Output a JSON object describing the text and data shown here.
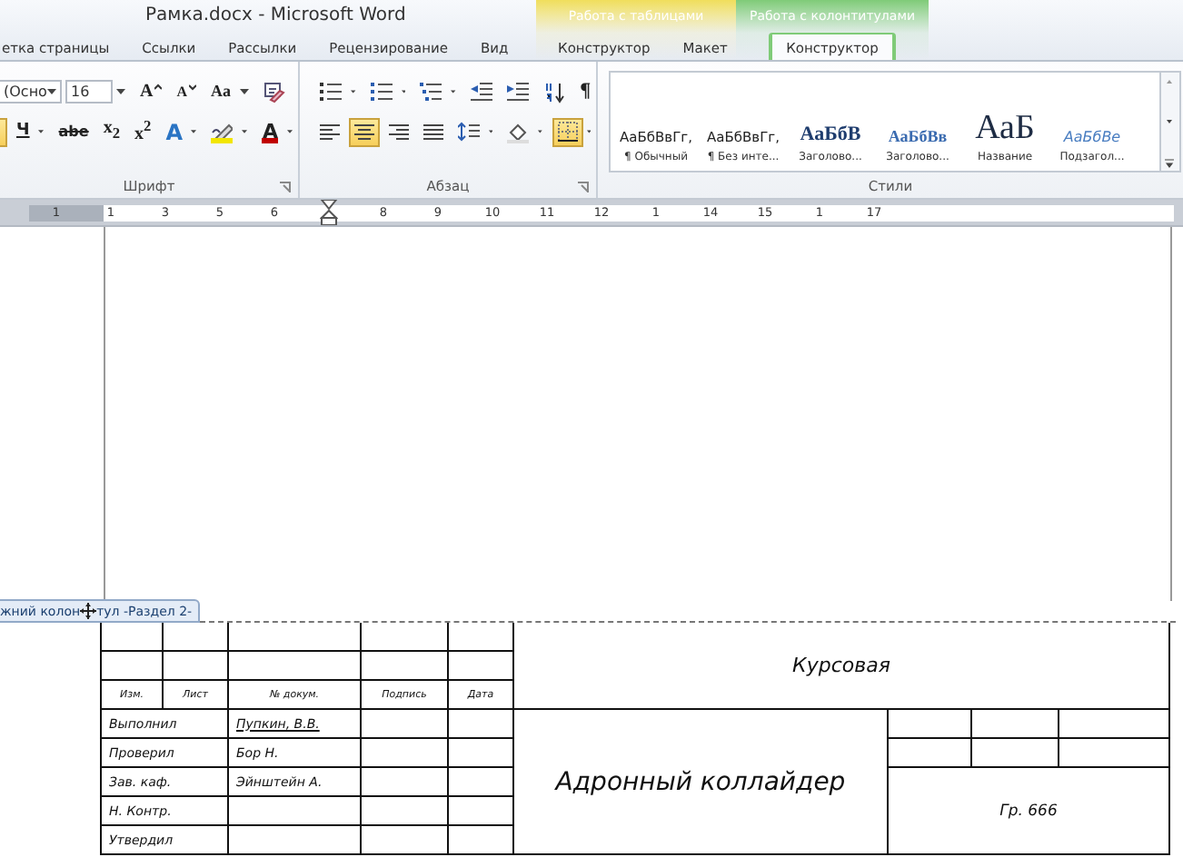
{
  "window": {
    "title": "Рамка.docx - Microsoft Word"
  },
  "tabs": [
    {
      "label": "етка страницы",
      "selected": false
    },
    {
      "label": "Ссылки",
      "selected": false
    },
    {
      "label": "Рассылки",
      "selected": false
    },
    {
      "label": "Рецензирование",
      "selected": false
    },
    {
      "label": "Вид",
      "selected": false
    }
  ],
  "context_groups": [
    {
      "label": "Работа с таблицами",
      "color": "#f0de5c",
      "tabs": [
        {
          "label": "Конструктор",
          "selected": false
        },
        {
          "label": "Макет",
          "selected": false
        }
      ]
    },
    {
      "label": "Работа с колонтитулами",
      "color": "#7fcb78",
      "tabs": [
        {
          "label": "Конструктор",
          "selected": true
        }
      ]
    }
  ],
  "font_group": {
    "label": "Шрифт",
    "font": "(Осно",
    "size": "16",
    "row1": [
      {
        "kind": "grow",
        "label": "A",
        "selected": false
      },
      {
        "kind": "shrink",
        "label": "A",
        "selected": false
      },
      {
        "kind": "case",
        "label": "Aa",
        "selected": false
      },
      {
        "kind": "clear",
        "selected": false
      }
    ],
    "row2": [
      {
        "kind": "edge",
        "selected": true
      },
      {
        "kind": "underline",
        "label": "Ч",
        "selected": false
      },
      {
        "kind": "strike",
        "label": "abe",
        "selected": false
      },
      {
        "kind": "sub",
        "label": "x$_{2}$",
        "selected": false
      },
      {
        "kind": "sup",
        "label": "x$^{2}$",
        "selected": false
      },
      {
        "kind": "effects",
        "label": "A",
        "selected": false
      },
      {
        "kind": "highlight",
        "color": "#f2e600",
        "selected": false
      },
      {
        "kind": "fontcolor",
        "label": "A",
        "color": "#c00000",
        "selected": false
      }
    ]
  },
  "paragraph_group": {
    "label": "Абзац",
    "row1": [
      {
        "kind": "bullets",
        "selected": false
      },
      {
        "kind": "numbering",
        "selected": false
      },
      {
        "kind": "multilevel",
        "selected": false
      },
      {
        "kind": "outdent",
        "selected": false
      },
      {
        "kind": "indent",
        "selected": false
      },
      {
        "kind": "sort",
        "selected": false
      },
      {
        "kind": "pilcrow",
        "label": "¶",
        "selected": false
      }
    ],
    "row2": [
      {
        "kind": "align-left",
        "selected": false
      },
      {
        "kind": "align-center",
        "selected": true
      },
      {
        "kind": "align-right",
        "selected": false
      },
      {
        "kind": "justify",
        "selected": false
      },
      {
        "kind": "spacing",
        "selected": false
      },
      {
        "kind": "shading",
        "selected": false
      },
      {
        "kind": "borders",
        "selected": true
      }
    ]
  },
  "styles_group": {
    "label": "Стили",
    "styles": [
      {
        "kind": "normal",
        "sample": "АаБбВвГг,",
        "name": "¶ Обычный"
      },
      {
        "kind": "normal",
        "sample": "АаБбВвГг,",
        "name": "¶ Без инте..."
      },
      {
        "kind": "heading1",
        "sample": "АаБбВ",
        "name": "Заголово..."
      },
      {
        "kind": "heading2",
        "sample": "АаБбВв",
        "name": "Заголово..."
      },
      {
        "kind": "title",
        "sample": "АаБ",
        "name": "Название"
      },
      {
        "kind": "subtitle",
        "sample": "АаБбВе",
        "name": "Подзагол..."
      }
    ]
  },
  "ruler": {
    "labels": [
      "1",
      "1",
      "3",
      "5",
      "6",
      "8",
      "9",
      "10",
      "11",
      "12",
      "1",
      "14",
      "15",
      "1",
      "17"
    ]
  },
  "footer_tag": {
    "before": "жний колон",
    "after": "тул -Раздел 2-"
  },
  "stamp": {
    "header_labels": [
      "Изм.",
      "Лист",
      "№ докум.",
      "Подпись",
      "Дата"
    ],
    "signers": [
      {
        "role": "Выполнил",
        "name": "Пупкин, В.В."
      },
      {
        "role": "Проверил",
        "name": "Бор Н."
      },
      {
        "role": "Зав. каф.",
        "name": "Эйнштейн А."
      },
      {
        "role": "Н. Контр."
      },
      {
        "role": "Утвердил"
      }
    ],
    "doc_type": "Курсовая",
    "title": "Адронный коллайдер",
    "group": "Гр. 666"
  }
}
